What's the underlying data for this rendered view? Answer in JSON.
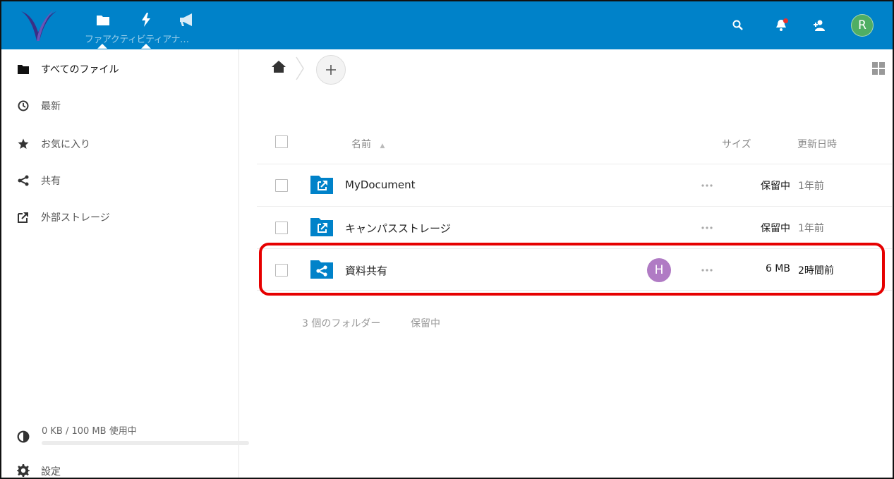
{
  "header": {
    "apps": [
      {
        "name": "files",
        "icon": "folder-icon"
      },
      {
        "name": "activity",
        "icon": "lightning-icon"
      },
      {
        "name": "announcements",
        "icon": "megaphone-icon"
      }
    ],
    "app_label": "ファアクティビティアナ…",
    "right_icons": [
      "search-icon",
      "notification-icon",
      "contacts-icon"
    ],
    "user_avatar": "R",
    "brand_color": "#0082c9"
  },
  "sidebar": {
    "items": [
      {
        "label": "すべてのファイル",
        "icon": "folder-icon",
        "active": true
      },
      {
        "label": "最新",
        "icon": "clock-icon"
      },
      {
        "label": "お気に入り",
        "icon": "star-icon"
      },
      {
        "label": "共有",
        "icon": "share-icon"
      },
      {
        "label": "外部ストレージ",
        "icon": "external-link-icon"
      }
    ],
    "quota": {
      "label": "0 KB / 100 MB 使用中",
      "fraction_used": 0
    },
    "settings_label": "設定"
  },
  "breadcrumb": {
    "home_icon": "home-icon",
    "add_button_label": "+"
  },
  "table": {
    "headers": {
      "name": "名前",
      "size": "サイズ",
      "modified": "更新日時"
    },
    "sort_indicator": "▲",
    "rows": [
      {
        "name": "MyDocument",
        "type": "external-folder",
        "size": "保留中",
        "modified": "1年前"
      },
      {
        "name": "キャンパスストレージ",
        "type": "external-folder",
        "size": "保留中",
        "modified": "1年前"
      },
      {
        "name": "資料共有",
        "type": "shared-folder",
        "shared_with": "H",
        "size": "6 MB",
        "modified": "2時間前",
        "highlighted": true
      }
    ],
    "summary": {
      "count": "3 個のフォルダー",
      "size": "保留中"
    }
  },
  "colors": {
    "highlight": "#e60000",
    "folder": "#0082c9",
    "share_avatar": "#b07bc4",
    "user_avatar": "#4fae64"
  }
}
